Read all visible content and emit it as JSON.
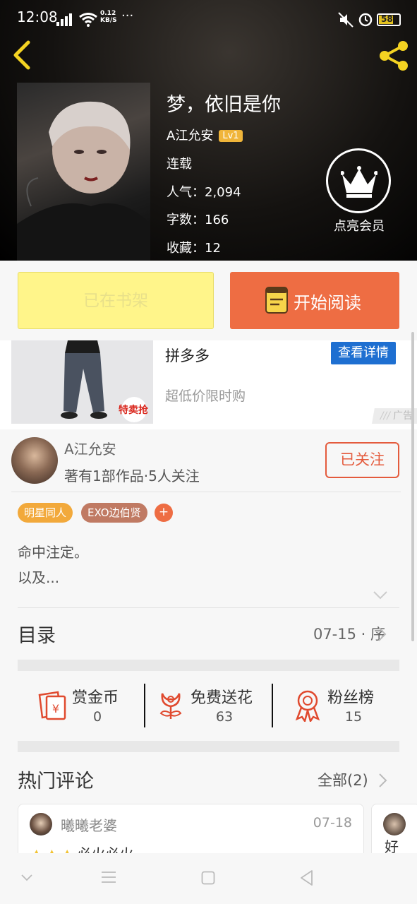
{
  "status_bar": {
    "time": "12:08",
    "net_speed": "0.12",
    "net_unit": "KB/S",
    "more": "···",
    "battery": "58"
  },
  "book": {
    "title": "梦，依旧是你",
    "author": "A江允安",
    "level": "Lv1",
    "status": "连载",
    "popularity_label": "人气：",
    "popularity": "2,094",
    "words_label": "字数：",
    "words": "166",
    "favorites_label": "收藏：",
    "favorites": "12",
    "vip_label": "点亮会员"
  },
  "actions": {
    "shelf_label": "已在书架",
    "read_label": "开始阅读"
  },
  "ad": {
    "title": "拼多多",
    "detail_label": "查看详情",
    "subtitle": "超低价限时购",
    "badge": "特卖抢",
    "mark": "广告"
  },
  "author_card": {
    "name": "A江允安",
    "stats": "著有1部作品·5人关注",
    "follow_label": "已关注"
  },
  "tags": [
    {
      "label": "明星同人",
      "color": "#f2a93b"
    },
    {
      "label": "EXO边伯贤",
      "color": "#c07a63"
    }
  ],
  "tag_add": "+",
  "intro": {
    "line1": "命中注定。",
    "line2": "以及..."
  },
  "toc": {
    "title": "目录",
    "latest": "07-15 · 序"
  },
  "stats": [
    {
      "label": "赏金币",
      "value": "0",
      "icon": "reward-coin-icon"
    },
    {
      "label": "免费送花",
      "value": "63",
      "icon": "flower-icon"
    },
    {
      "label": "粉丝榜",
      "value": "15",
      "icon": "medal-icon"
    }
  ],
  "comments": {
    "title": "热门评论",
    "all_label": "全部(2)",
    "items": [
      {
        "user": "曦曦老婆",
        "date": "07-18",
        "text": "必火必火"
      }
    ],
    "next_preview": "好"
  },
  "colors": {
    "accent": "#ee6d43",
    "shelf": "#fff58a",
    "link_blue": "#1e6fd1",
    "follow": "#e45b3d"
  }
}
